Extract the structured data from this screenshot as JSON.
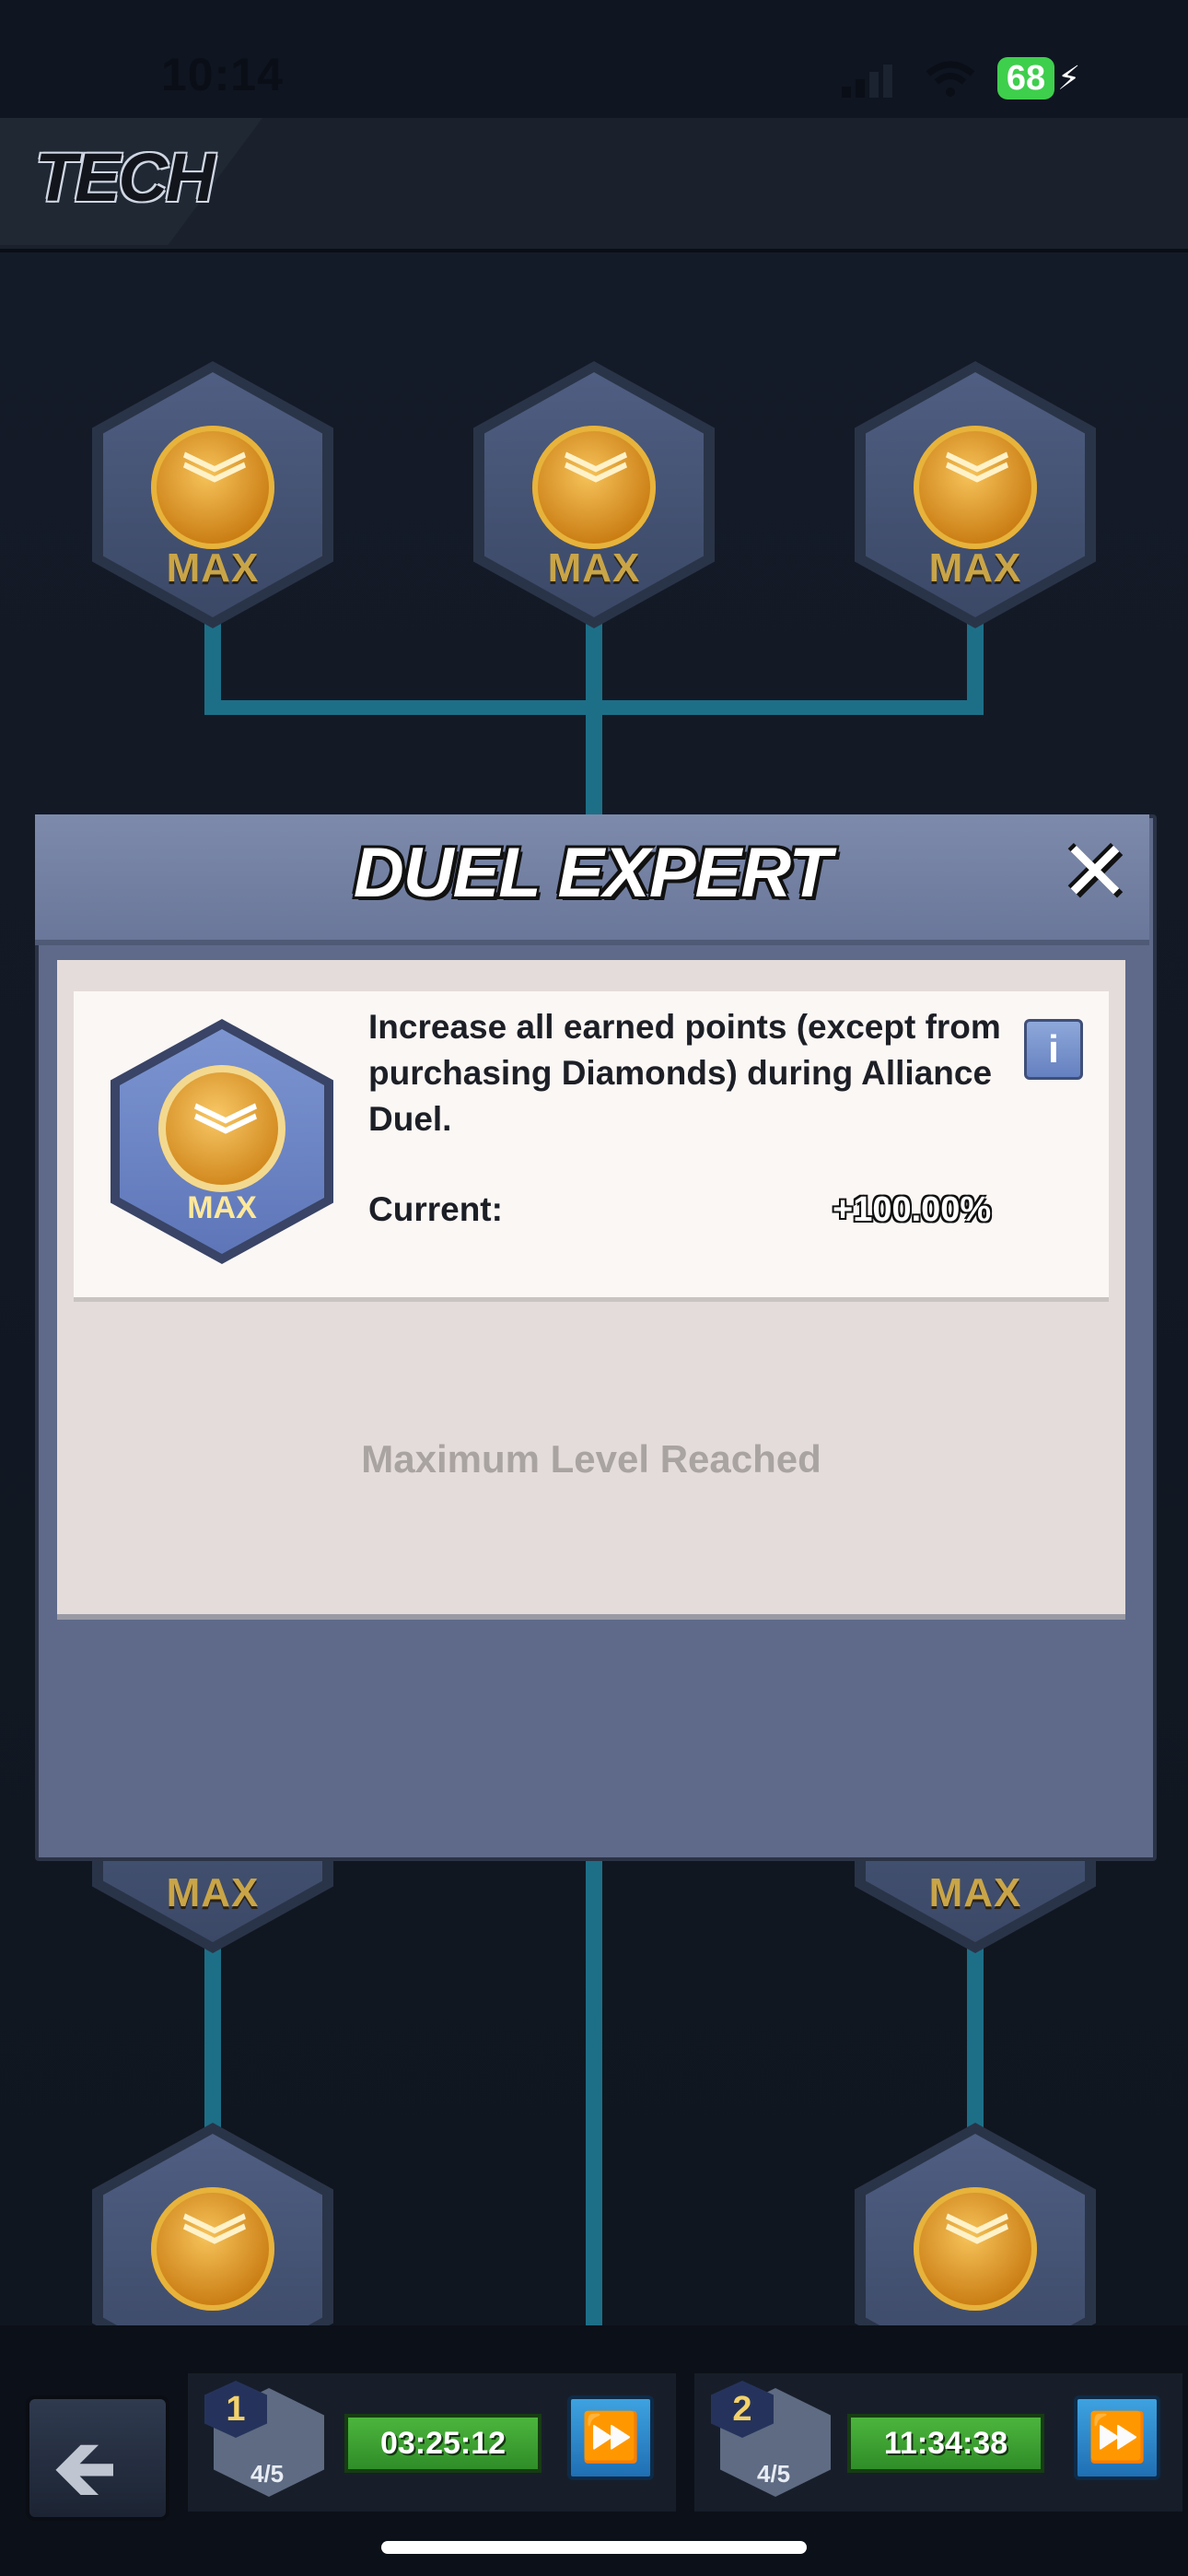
{
  "status_bar": {
    "time": "10:14",
    "battery": "68"
  },
  "header": {
    "title": "TECH"
  },
  "tree": {
    "node_label": "MAX"
  },
  "modal": {
    "title": "DUEL EXPERT",
    "icon_label": "MAX",
    "description": "Increase all earned points (except from purchasing Diamonds) during Alliance Duel.",
    "current_label": "Current:",
    "current_value": "+100.00%",
    "max_text": "Maximum Level Reached",
    "info_icon": "i"
  },
  "queues": [
    {
      "slot": "1",
      "progress": "4/5",
      "timer": "03:25:12"
    },
    {
      "slot": "2",
      "progress": "4/5",
      "timer": "11:34:38"
    }
  ],
  "colors": {
    "connector": "#1d6f87",
    "timer_green": "#3fa833",
    "speedup_blue": "#2f88cc"
  },
  "icons": [
    "back-arrow-icon",
    "fast-forward-icon",
    "close-icon",
    "info-icon",
    "chevron-coin-icon"
  ]
}
